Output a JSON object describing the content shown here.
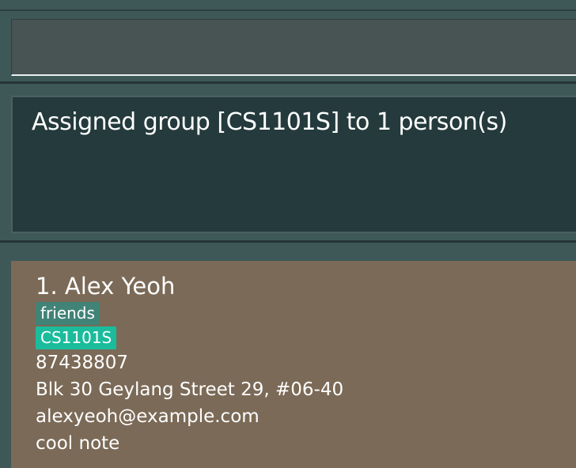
{
  "command_box": {
    "value": "",
    "placeholder": ""
  },
  "result": {
    "message": "Assigned group [CS1101S] to 1 person(s)"
  },
  "person_list": {
    "persons": [
      {
        "index_name": "1. Alex Yeoh",
        "tags": [
          "friends"
        ],
        "groups": [
          "CS1101S"
        ],
        "phone": "87438807",
        "address": "Blk 30 Geylang Street 29, #06-40",
        "email": "alexyeoh@example.com",
        "note": "cool note"
      }
    ]
  },
  "colors": {
    "window_bg": "#3e5858",
    "command_bg": "#485454",
    "result_bg": "#243a3c",
    "card_bg": "#7b6a57",
    "tag_bg": "#418377",
    "group_tag_bg": "#1abc9c"
  }
}
